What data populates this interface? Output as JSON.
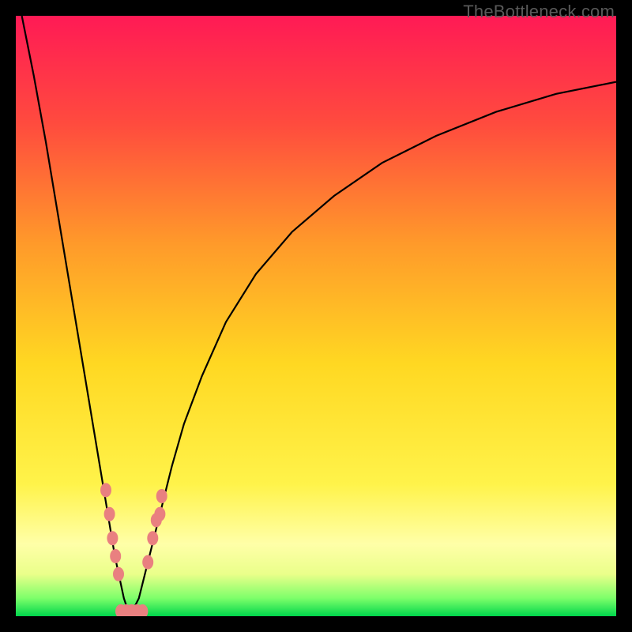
{
  "watermark": "TheBottleneck.com",
  "colors": {
    "frame": "#000000",
    "gradient_top": "#ff1a55",
    "gradient_mid1": "#ff7a2a",
    "gradient_mid2": "#ffe822",
    "gradient_low": "#f7ff59",
    "gradient_band": "#ffffb0",
    "gradient_green": "#00e04c",
    "curve": "#000000",
    "marker": "#e98080"
  },
  "chart_data": {
    "type": "line",
    "title": "",
    "xlabel": "",
    "ylabel": "",
    "xlim": [
      0,
      100
    ],
    "ylim": [
      0,
      100
    ],
    "note": "x in percent of plot width, y in percent bottleneck (0 at bottom, 100 at top). Left branch descends from top-left to a minimum near x≈19, right branch rises toward top-right.",
    "series": [
      {
        "name": "left_branch",
        "x": [
          1,
          3,
          5,
          7,
          9,
          11,
          13,
          15,
          16.5,
          18,
          19
        ],
        "y": [
          100,
          90,
          79,
          67,
          55,
          43,
          31,
          19,
          10,
          3,
          0
        ]
      },
      {
        "name": "right_branch",
        "x": [
          19,
          20.5,
          22,
          24,
          26,
          28,
          31,
          35,
          40,
          46,
          53,
          61,
          70,
          80,
          90,
          100
        ],
        "y": [
          0,
          3,
          9,
          17,
          25,
          32,
          40,
          49,
          57,
          64,
          70,
          75.5,
          80,
          84,
          87,
          89
        ]
      }
    ],
    "markers": {
      "name": "highlighted_points",
      "note": "Salmon rounded markers clustered near the curve minimum on both branches, plus a short flat cluster at the very bottom.",
      "points": [
        {
          "x": 15.0,
          "y": 21
        },
        {
          "x": 15.6,
          "y": 17
        },
        {
          "x": 16.1,
          "y": 13
        },
        {
          "x": 16.6,
          "y": 10
        },
        {
          "x": 17.1,
          "y": 7
        },
        {
          "x": 22.0,
          "y": 9
        },
        {
          "x": 22.8,
          "y": 13
        },
        {
          "x": 23.4,
          "y": 16
        },
        {
          "x": 24.3,
          "y": 20
        },
        {
          "x": 24.0,
          "y": 17
        },
        {
          "x": 17.5,
          "y": 0.8
        },
        {
          "x": 18.4,
          "y": 0.8
        },
        {
          "x": 19.3,
          "y": 0.8
        },
        {
          "x": 20.2,
          "y": 0.8
        },
        {
          "x": 21.1,
          "y": 0.8
        }
      ]
    }
  }
}
